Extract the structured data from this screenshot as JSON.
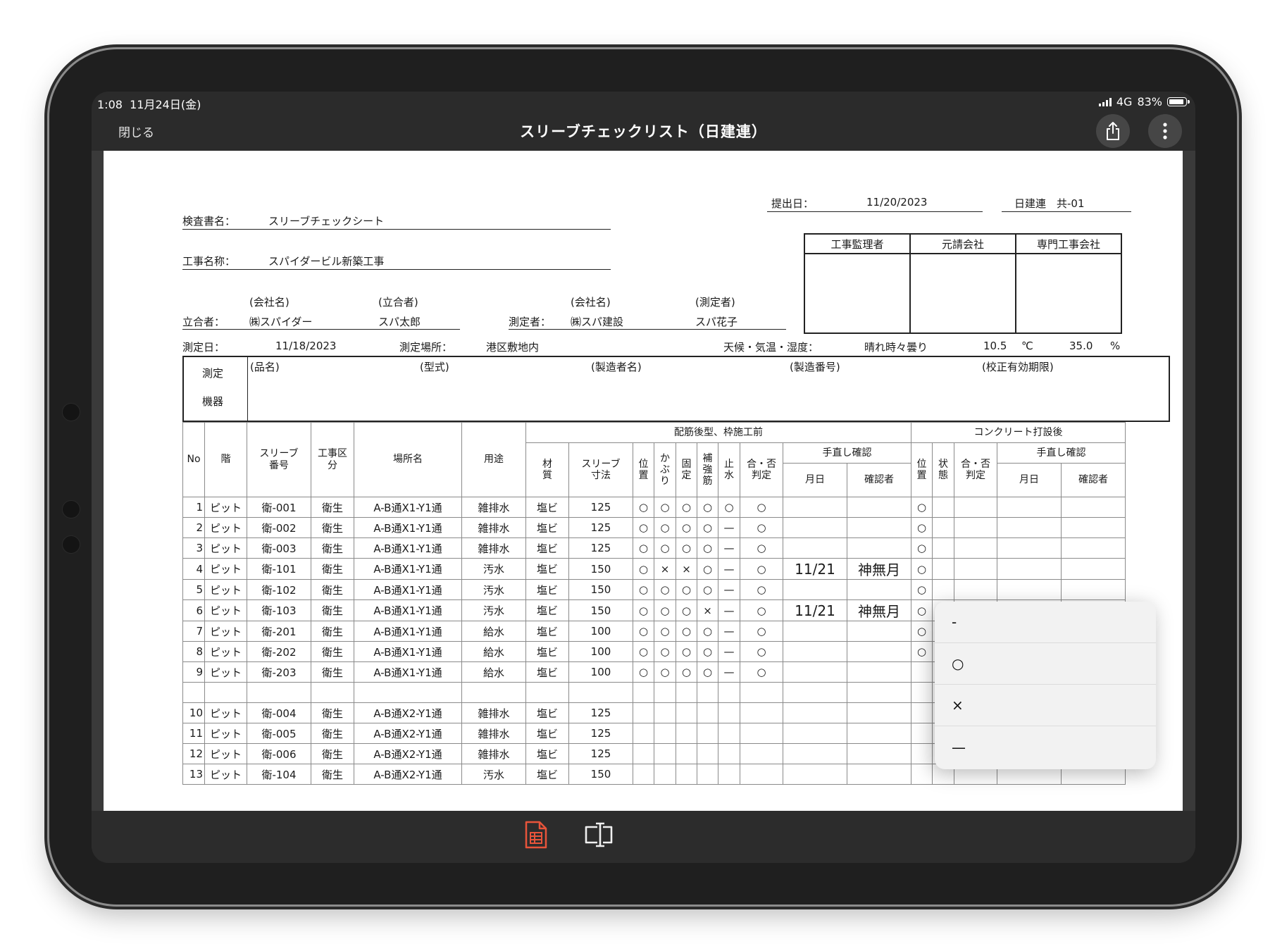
{
  "status_bar": {
    "time": "1:08",
    "date": "11月24日(金)",
    "network": "4G",
    "battery": "83%",
    "battery_level": 0.83
  },
  "nav": {
    "close_label": "閉じる",
    "title": "スリーブチェックリスト（日建連）",
    "share_icon": "share-icon",
    "more_icon": "more-vertical-icon"
  },
  "doc": {
    "submit_label": "提出日：",
    "submit_date": "11/20/2023",
    "doc_code": "日建連　共-01",
    "inspection_label": "検査書名：",
    "inspection_name": "スリーブチェックシート",
    "project_label": "工事名称：",
    "project_name": "スパイダービル新築工事",
    "approval_headers": [
      "工事監理者",
      "元請会社",
      "専門工事会社"
    ],
    "witness": {
      "label": "立合者：",
      "company_hdr": "(会社名)",
      "person_hdr": "(立合者)",
      "company": "㈱スパイダー",
      "person": "スパ太郎"
    },
    "measurer": {
      "label": "測定者：",
      "company_hdr": "(会社名)",
      "person_hdr": "(測定者)",
      "company": "㈱スパ建設",
      "person": "スパ花子"
    },
    "measure_date_label": "測定日：",
    "measure_date": "11/18/2023",
    "place_label": "測定場所：",
    "place": "港区敷地内",
    "weather_label": "天候・気温・湿度：",
    "weather": "晴れ時々曇り",
    "temp": "10.5",
    "temp_unit": "℃",
    "humidity": "35.0",
    "humidity_unit": "%",
    "instrument_label_1": "測定",
    "instrument_label_2": "機器",
    "instrument_fields": [
      "(品名)",
      "(型式)",
      "(製造者名)",
      "(製造番号)",
      "(校正有効期限)"
    ]
  },
  "table": {
    "headers": {
      "no": "No",
      "floor": "階",
      "sleeve_no": "スリーブ\n番号",
      "trade": "工事区\n分",
      "location": "場所名",
      "use": "用途",
      "group_before": "配筋後型、枠施工前",
      "group_after": "コンクリート打設後",
      "material": "材\n質",
      "size": "スリーブ\n寸法",
      "position": "位\n置",
      "cover": "か\nぶ\nり",
      "fix": "固\n定",
      "rebar": "補\n強\n筋",
      "waterstop": "止\n水",
      "judge": "合・否\n判定",
      "fix_check": "手直し確認",
      "date": "月日",
      "checker": "確認者",
      "after_position": "位\n置",
      "after_state": "状\n態",
      "after_judge": "合・否\n判定",
      "after_fix_check": "手直し確認",
      "after_date": "月日",
      "after_checker": "確認者"
    },
    "rows": [
      {
        "no": "1",
        "floor": "ピット",
        "sleeve": "衛-001",
        "trade": "衛生",
        "loc": "A-B通X1-Y1通",
        "use": "雑排水",
        "mat": "塩ビ",
        "size": "125",
        "pos": "○",
        "cov": "○",
        "fix": "○",
        "reb": "○",
        "ws": "○",
        "judge": "○",
        "date": "",
        "checker": "",
        "a_pos": "○"
      },
      {
        "no": "2",
        "floor": "ピット",
        "sleeve": "衛-002",
        "trade": "衛生",
        "loc": "A-B通X1-Y1通",
        "use": "雑排水",
        "mat": "塩ビ",
        "size": "125",
        "pos": "○",
        "cov": "○",
        "fix": "○",
        "reb": "○",
        "ws": "—",
        "judge": "○",
        "date": "",
        "checker": "",
        "a_pos": "○"
      },
      {
        "no": "3",
        "floor": "ピット",
        "sleeve": "衛-003",
        "trade": "衛生",
        "loc": "A-B通X1-Y1通",
        "use": "雑排水",
        "mat": "塩ビ",
        "size": "125",
        "pos": "○",
        "cov": "○",
        "fix": "○",
        "reb": "○",
        "ws": "—",
        "judge": "○",
        "date": "",
        "checker": "",
        "a_pos": "○"
      },
      {
        "no": "4",
        "floor": "ピット",
        "sleeve": "衛-101",
        "trade": "衛生",
        "loc": "A-B通X1-Y1通",
        "use": "汚水",
        "mat": "塩ビ",
        "size": "150",
        "pos": "○",
        "cov": "×",
        "fix": "×",
        "reb": "○",
        "ws": "—",
        "judge": "○",
        "date": "11/21",
        "checker": "神無月",
        "a_pos": "○"
      },
      {
        "no": "5",
        "floor": "ピット",
        "sleeve": "衛-102",
        "trade": "衛生",
        "loc": "A-B通X1-Y1通",
        "use": "汚水",
        "mat": "塩ビ",
        "size": "150",
        "pos": "○",
        "cov": "○",
        "fix": "○",
        "reb": "○",
        "ws": "—",
        "judge": "○",
        "date": "",
        "checker": "",
        "a_pos": "○"
      },
      {
        "no": "6",
        "floor": "ピット",
        "sleeve": "衛-103",
        "trade": "衛生",
        "loc": "A-B通X1-Y1通",
        "use": "汚水",
        "mat": "塩ビ",
        "size": "150",
        "pos": "○",
        "cov": "○",
        "fix": "○",
        "reb": "×",
        "ws": "—",
        "judge": "○",
        "date": "11/21",
        "checker": "神無月",
        "a_pos": "○"
      },
      {
        "no": "7",
        "floor": "ピット",
        "sleeve": "衛-201",
        "trade": "衛生",
        "loc": "A-B通X1-Y1通",
        "use": "給水",
        "mat": "塩ビ",
        "size": "100",
        "pos": "○",
        "cov": "○",
        "fix": "○",
        "reb": "○",
        "ws": "—",
        "judge": "○",
        "date": "",
        "checker": "",
        "a_pos": "○"
      },
      {
        "no": "8",
        "floor": "ピット",
        "sleeve": "衛-202",
        "trade": "衛生",
        "loc": "A-B通X1-Y1通",
        "use": "給水",
        "mat": "塩ビ",
        "size": "100",
        "pos": "○",
        "cov": "○",
        "fix": "○",
        "reb": "○",
        "ws": "—",
        "judge": "○",
        "date": "",
        "checker": "",
        "a_pos": "○"
      },
      {
        "no": "9",
        "floor": "ピット",
        "sleeve": "衛-203",
        "trade": "衛生",
        "loc": "A-B通X1-Y1通",
        "use": "給水",
        "mat": "塩ビ",
        "size": "100",
        "pos": "○",
        "cov": "○",
        "fix": "○",
        "reb": "○",
        "ws": "—",
        "judge": "○",
        "date": "",
        "checker": "",
        "a_pos": ""
      },
      {
        "no": "",
        "floor": "",
        "sleeve": "",
        "trade": "",
        "loc": "",
        "use": "",
        "mat": "",
        "size": "",
        "pos": "",
        "cov": "",
        "fix": "",
        "reb": "",
        "ws": "",
        "judge": "",
        "date": "",
        "checker": "",
        "a_pos": ""
      },
      {
        "no": "10",
        "floor": "ピット",
        "sleeve": "衛-004",
        "trade": "衛生",
        "loc": "A-B通X2-Y1通",
        "use": "雑排水",
        "mat": "塩ビ",
        "size": "125",
        "pos": "",
        "cov": "",
        "fix": "",
        "reb": "",
        "ws": "",
        "judge": "",
        "date": "",
        "checker": "",
        "a_pos": ""
      },
      {
        "no": "11",
        "floor": "ピット",
        "sleeve": "衛-005",
        "trade": "衛生",
        "loc": "A-B通X2-Y1通",
        "use": "雑排水",
        "mat": "塩ビ",
        "size": "125",
        "pos": "",
        "cov": "",
        "fix": "",
        "reb": "",
        "ws": "",
        "judge": "",
        "date": "",
        "checker": "",
        "a_pos": ""
      },
      {
        "no": "12",
        "floor": "ピット",
        "sleeve": "衛-006",
        "trade": "衛生",
        "loc": "A-B通X2-Y1通",
        "use": "雑排水",
        "mat": "塩ビ",
        "size": "125",
        "pos": "",
        "cov": "",
        "fix": "",
        "reb": "",
        "ws": "",
        "judge": "",
        "date": "",
        "checker": "",
        "a_pos": ""
      },
      {
        "no": "13",
        "floor": "ピット",
        "sleeve": "衛-104",
        "trade": "衛生",
        "loc": "A-B通X2-Y1通",
        "use": "汚水",
        "mat": "塩ビ",
        "size": "150",
        "pos": "",
        "cov": "",
        "fix": "",
        "reb": "",
        "ws": "",
        "judge": "",
        "date": "",
        "checker": "",
        "a_pos": ""
      }
    ],
    "selected_cell_row": 9,
    "selected_cell_col": "after_state"
  },
  "dropdown": {
    "options": [
      "-",
      "○",
      "×",
      "—"
    ]
  },
  "toolbar": {
    "sheet_icon": "spreadsheet-icon",
    "text_field_icon": "text-field-icon",
    "active_color": "#e8543a"
  },
  "colors": {
    "accent": "#e8543a",
    "selection_border": "#e23b3b",
    "selection_fill": "#f2b8b8"
  }
}
